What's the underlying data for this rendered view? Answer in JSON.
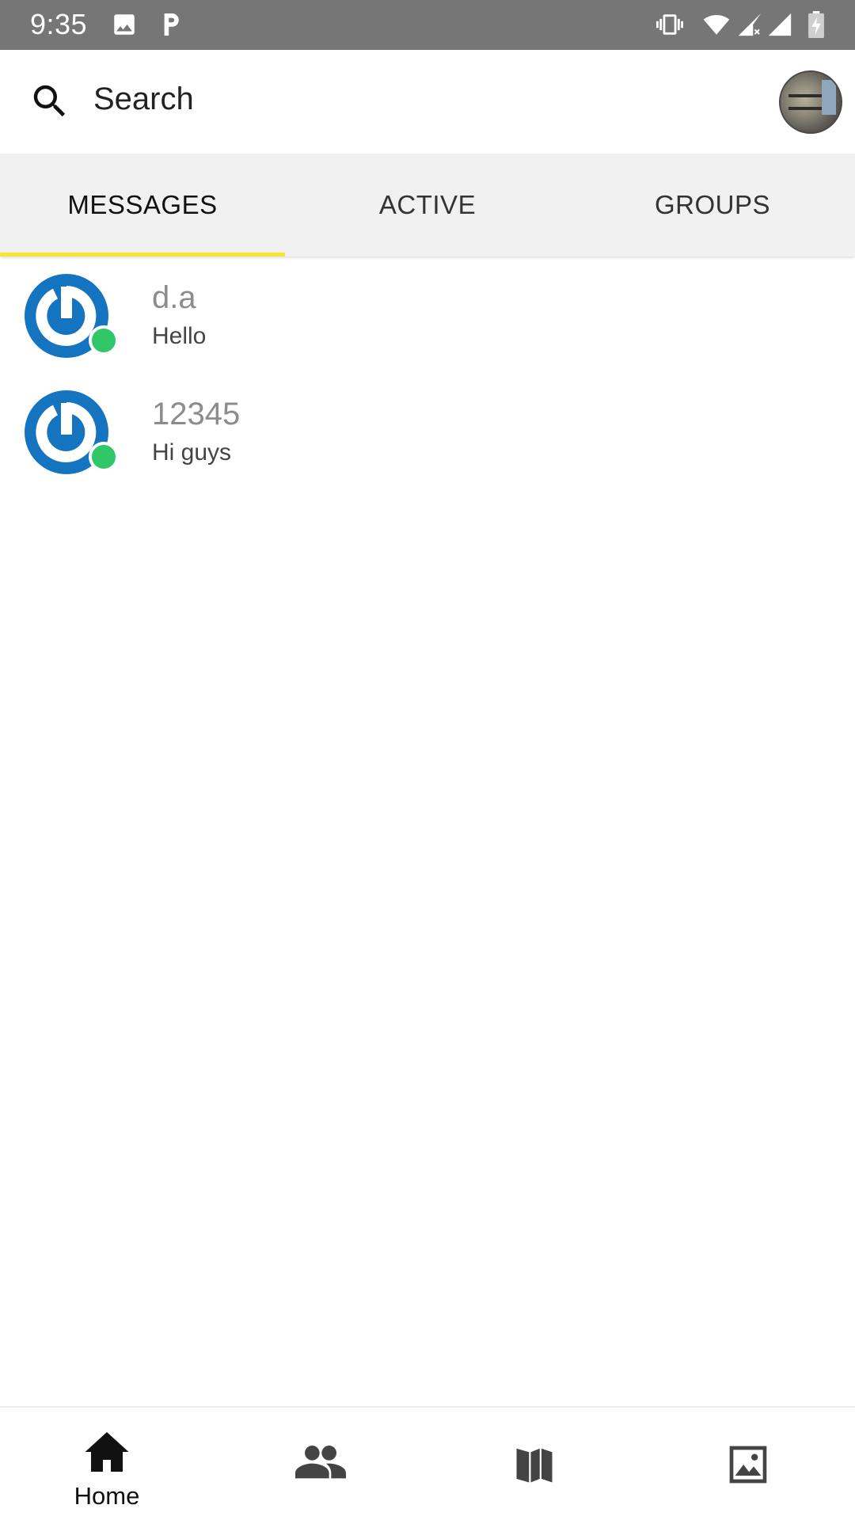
{
  "status_bar": {
    "time": "9:35",
    "icons": [
      "gallery-icon",
      "p-icon",
      "vibrate-icon",
      "wifi-icon",
      "signal-no-data-icon",
      "signal-icon",
      "battery-charging-icon"
    ]
  },
  "header": {
    "search_label": "Search",
    "search_icon": "search-icon",
    "profile_avatar": "profile-avatar"
  },
  "tabs": [
    {
      "label": "MESSAGES",
      "active": true
    },
    {
      "label": "ACTIVE",
      "active": false
    },
    {
      "label": "GROUPS",
      "active": false
    }
  ],
  "conversations": [
    {
      "name": "d.a",
      "message": "Hello",
      "online": true
    },
    {
      "name": "12345",
      "message": "Hi guys",
      "online": true
    }
  ],
  "bottom_nav": [
    {
      "label": "Home",
      "icon": "home-icon",
      "active": true
    },
    {
      "label": "",
      "icon": "people-icon",
      "active": false
    },
    {
      "label": "",
      "icon": "map-icon",
      "active": false
    },
    {
      "label": "",
      "icon": "image-icon",
      "active": false
    }
  ],
  "colors": {
    "status_bar_bg": "#767676",
    "tab_bar_bg": "#f1f1f1",
    "tab_indicator": "#f5e633",
    "avatar_blue": "#1574bf",
    "online_green": "#2fc768"
  }
}
